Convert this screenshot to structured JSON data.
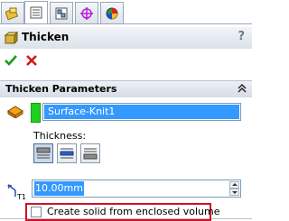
{
  "tabs": [
    {
      "icon": "feature-manager-icon"
    },
    {
      "icon": "property-manager-icon",
      "active": true
    },
    {
      "icon": "configuration-manager-icon"
    },
    {
      "icon": "dimxpert-manager-icon"
    },
    {
      "icon": "display-manager-icon"
    }
  ],
  "panel": {
    "title": "Thicken",
    "help": "?",
    "title_icon": "thicken-feature-icon",
    "ok_icon": "checkmark-icon",
    "cancel_icon": "x-icon"
  },
  "group": {
    "title": "Thicken Parameters",
    "collapse_icon": "double-chevron-up-icon",
    "selected_surface": "Surface-Knit1",
    "thickness_label": "Thickness:",
    "thickness_value": "10.00mm",
    "thickness_sides": [
      "thicken-side-1-icon",
      "thicken-both-sides-icon",
      "thicken-side-2-icon"
    ],
    "selected_side_index": 0,
    "checkbox_label": "Create solid from enclosed volume",
    "checkbox_checked": false
  },
  "colors": {
    "selection_blue": "#3399ff",
    "selection_marker_green": "#1fd11f",
    "ok_green": "#1a9a1a",
    "cancel_red": "#cc1a1a",
    "highlight_red": "#d0102a"
  }
}
